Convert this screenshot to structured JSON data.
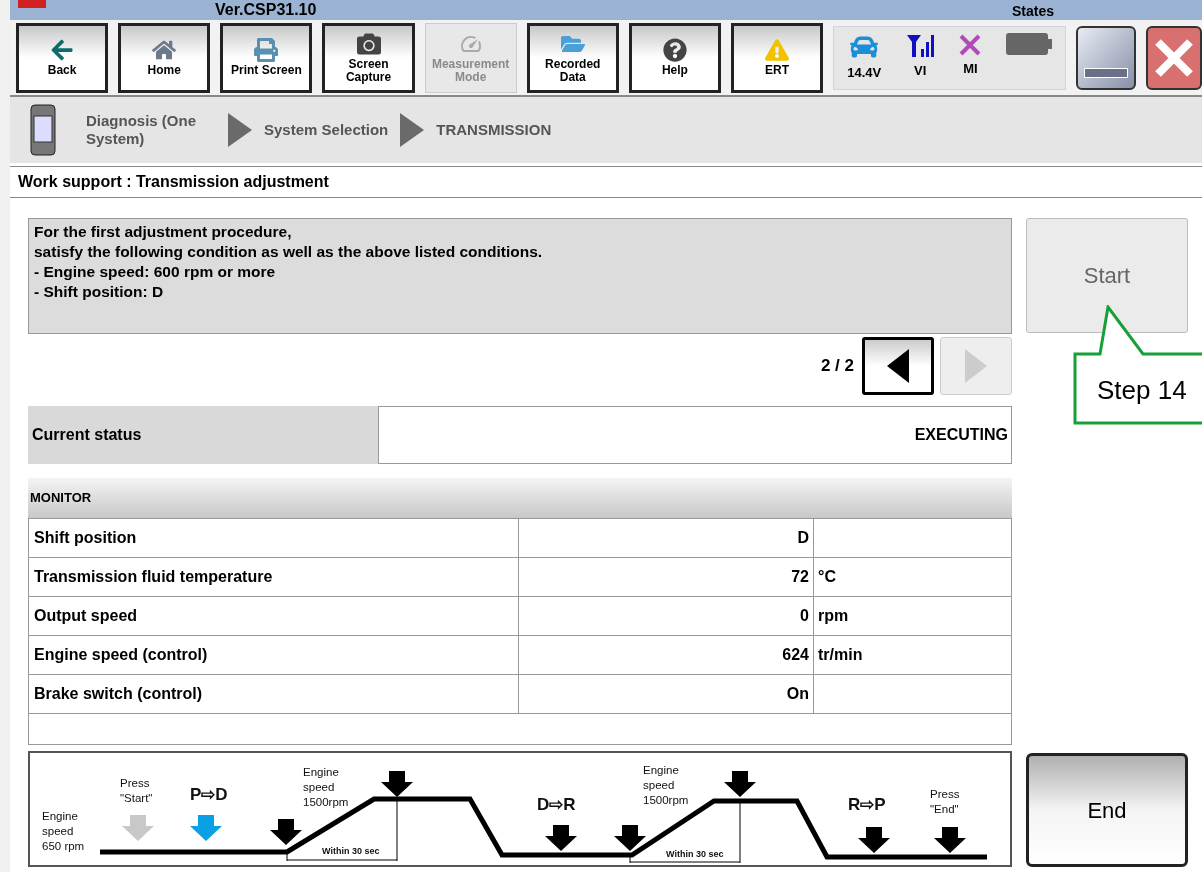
{
  "title_strip": {
    "version": "Ver.CSP31.10",
    "states_label": "States"
  },
  "toolbar": {
    "buttons": [
      {
        "kind": "back",
        "label": "Back",
        "disabled": false
      },
      {
        "kind": "home",
        "label": "Home",
        "disabled": false
      },
      {
        "kind": "print",
        "label": "Print Screen",
        "disabled": false
      },
      {
        "kind": "capture",
        "label": "Screen Capture",
        "disabled": false
      },
      {
        "kind": "measure",
        "label": "Measurement Mode",
        "disabled": true
      },
      {
        "kind": "recorded",
        "label": "Recorded Data",
        "disabled": false
      },
      {
        "kind": "help",
        "label": "Help",
        "disabled": false
      },
      {
        "kind": "ert",
        "label": "ERT",
        "disabled": false
      }
    ],
    "status": [
      {
        "kind": "vehicle",
        "label": "14.4V"
      },
      {
        "kind": "vi",
        "label": "VI"
      },
      {
        "kind": "mi",
        "label": "MI"
      },
      {
        "kind": "battery"
      }
    ]
  },
  "breadcrumb": [
    "Diagnosis (One System)",
    "System Selection",
    "TRANSMISSION"
  ],
  "header": "Work support : Transmission adjustment",
  "message": [
    "For the first adjustment procedure,",
    "satisfy the following condition as well as the above listed conditions.",
    "- Engine speed: 600 rpm or more",
    "- Shift position: D"
  ],
  "pager": {
    "text": "2 / 2",
    "prev_disabled": false,
    "next_disabled": true
  },
  "start_button": {
    "label": "Start",
    "disabled": true
  },
  "callout": "Step 14",
  "current_status": {
    "label": "Current status",
    "value": "EXECUTING"
  },
  "monitor": {
    "title": "MONITOR",
    "rows": [
      {
        "name": "Shift position",
        "value": "D"
      },
      {
        "name": "Transmission fluid temperature",
        "value": "72",
        "unit": "°C"
      },
      {
        "name": "Output speed",
        "value": "0",
        "unit": "rpm"
      },
      {
        "name": "Engine speed (control)",
        "value": "624",
        "unit": "tr/min"
      },
      {
        "name": "Brake switch (control)",
        "value": "On"
      }
    ]
  },
  "diagram": {
    "start_speed": "Engine speed 650 rpm",
    "press_start": "Press \"Start\"",
    "shift_1": "P⇨D",
    "speed_1": "Engine speed 1500rpm",
    "within_1": "Within 30 sec",
    "shift_2": "D⇨R",
    "speed_2": "Engine speed 1500rpm",
    "within_2": "Within 30 sec",
    "shift_3": "R⇨P",
    "press_end": "Press \"End\""
  },
  "end_button": {
    "label": "End"
  }
}
